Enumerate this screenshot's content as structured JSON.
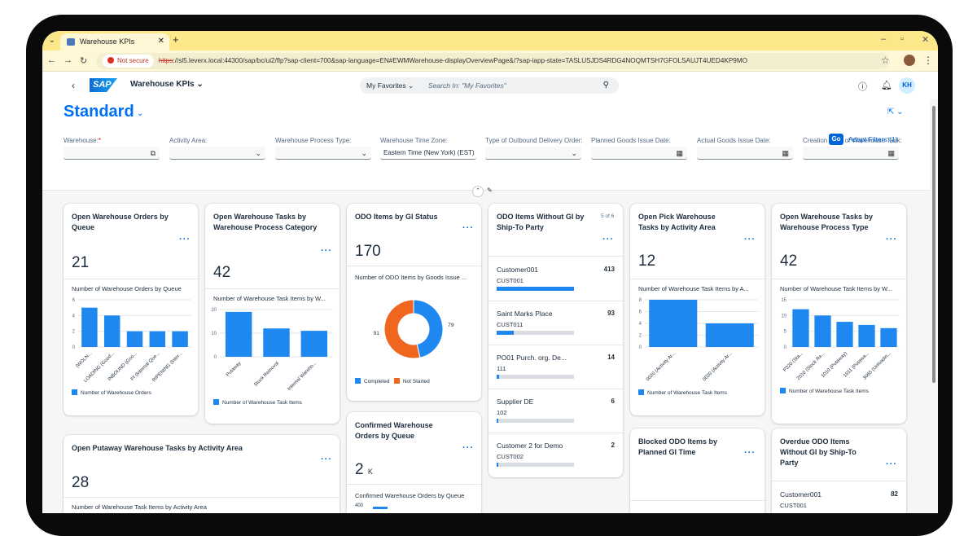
{
  "browser": {
    "tab_title": "Warehouse KPIs",
    "not_secure": "Not secure",
    "url_scheme": "https",
    "url_rest": "://sl5.leverx.local:44300/sap/bc/ui2/flp?sap-client=700&sap-language=EN#EWMWarehouse-displayOverviewPage&/?sap-iapp-state=TASLUSJDS4RDG4NOQMTSH7GFOLSAUJT4UED4KP9MO"
  },
  "shell": {
    "logo": "SAP",
    "title": "Warehouse KPIs",
    "search_scope": "My Favorites",
    "search_placeholder": "Search In: \"My Favorites\"",
    "avatar": "KH"
  },
  "filterbar": {
    "variant": "Standard",
    "filters": [
      {
        "label": "Warehouse:",
        "required": "*",
        "value": ""
      },
      {
        "label": "Activity Area:",
        "value": ""
      },
      {
        "label": "Warehouse Process Type:",
        "value": ""
      },
      {
        "label": "Warehouse Time Zone:",
        "value": "Eastern Time (New York) (EST)"
      },
      {
        "label": "Type of Outbound Delivery Order:",
        "value": ""
      },
      {
        "label": "Planned Goods Issue Date:",
        "value": ""
      },
      {
        "label": "Actual Goods Issue Date:",
        "value": ""
      },
      {
        "label": "Creation Date of Warehouse Task:",
        "value": ""
      }
    ],
    "go": "Go",
    "adapt": "Adapt Filters (1)"
  },
  "cards": {
    "c1": {
      "title": "Open Warehouse Orders by Queue",
      "kpi": "21",
      "subtitle": "Number of Warehouse Orders by Queue",
      "legend": "Number of Warehouse Orders"
    },
    "c2": {
      "title": "Open Warehouse Tasks by Warehouse Process Category",
      "kpi": "42",
      "subtitle": "Number of Warehouse Task Items by W...",
      "legend": "Number of Warehouse Task Items"
    },
    "c3": {
      "title": "ODO Items by GI Status",
      "kpi": "170",
      "subtitle": "Number of ODO Items by Goods Issue ...",
      "legend_a": "Completed",
      "legend_b": "Not Started"
    },
    "c4": {
      "title": "ODO Items Without GI by Ship-To Party",
      "count": "5 of 6",
      "items": [
        {
          "name": "Customer001",
          "id": "CUST001",
          "value": "413",
          "fill": 1.0
        },
        {
          "name": "Saint Marks Place",
          "id": "CUST011",
          "value": "93",
          "fill": 0.225
        },
        {
          "name": "PO01 Purch. org. De...",
          "id": "111",
          "value": "14",
          "fill": 0.034
        },
        {
          "name": "Supplier DE",
          "id": "102",
          "value": "6",
          "fill": 0.015
        },
        {
          "name": "Customer 2 for Demo",
          "id": "CUST002",
          "value": "2",
          "fill": 0.005
        }
      ]
    },
    "c5": {
      "title": "Open Pick Warehouse Tasks by Activity Area",
      "kpi": "12",
      "subtitle": "Number of Warehouse Task Items by A...",
      "legend": "Number of Warehouse Task Items"
    },
    "c6": {
      "title": "Open Warehouse Tasks by Warehouse Process Type",
      "kpi": "42",
      "subtitle": "Number of Warehouse Task Items by W...",
      "legend": "Number of Warehouse Task Items"
    },
    "c7": {
      "title": "Open Putaway Warehouse Tasks by Activity Area",
      "kpi": "28",
      "subtitle": "Number of Warehouse Task Items by Activity Area"
    },
    "c8": {
      "title": "Confirmed Warehouse Orders by Queue",
      "kpi": "2",
      "kpi_unit": "K",
      "subtitle": "Confirmed Warehouse Orders by Queue",
      "tick": "400"
    },
    "c9": {
      "title": "Blocked ODO Items by Planned GI Time"
    },
    "c10": {
      "title": "Overdue ODO Items Without GI by Ship-To Party",
      "item_name": "Customer001",
      "item_value": "82",
      "item_id": "CUST001"
    }
  },
  "chart_data": [
    {
      "type": "bar",
      "categories": [
        "(WOLN...",
        "LOADING (Good...",
        "INBOUND (Goo...",
        "PI (Internal Que...",
        "RIPENING (Inter..."
      ],
      "values": [
        5,
        4,
        2,
        2,
        2
      ],
      "ylim": [
        0,
        6
      ],
      "yticks": [
        "0",
        "2",
        "4",
        "6"
      ]
    },
    {
      "type": "bar",
      "categories": [
        "Putaway",
        "Stock Removal",
        "Internal Wareho..."
      ],
      "values": [
        19,
        12,
        11
      ],
      "ylim": [
        0,
        20
      ],
      "yticks": [
        "0",
        "10",
        "20"
      ]
    },
    {
      "type": "pie",
      "categories": [
        "Completed",
        "Not Started"
      ],
      "values": [
        79,
        91
      ],
      "colors": [
        "#1e88f0",
        "#f0661f"
      ]
    },
    {
      "type": "bar",
      "categories": [
        "0020 (Activity Ar...",
        "0020 (Activity Ar..."
      ],
      "values": [
        8,
        4
      ],
      "ylim": [
        0,
        8
      ],
      "yticks": [
        "0",
        "2",
        "4",
        "6",
        "8"
      ]
    },
    {
      "type": "bar",
      "categories": [
        "P320 (Sta...",
        "2010 (Stock Re...",
        "1010 (Putaway)",
        "1011 (Putawa...",
        "3065 (Unloadin..."
      ],
      "values": [
        12,
        10,
        8,
        7,
        6
      ],
      "ylim": [
        0,
        15
      ],
      "yticks": [
        "0",
        "5",
        "10",
        "15"
      ]
    }
  ]
}
